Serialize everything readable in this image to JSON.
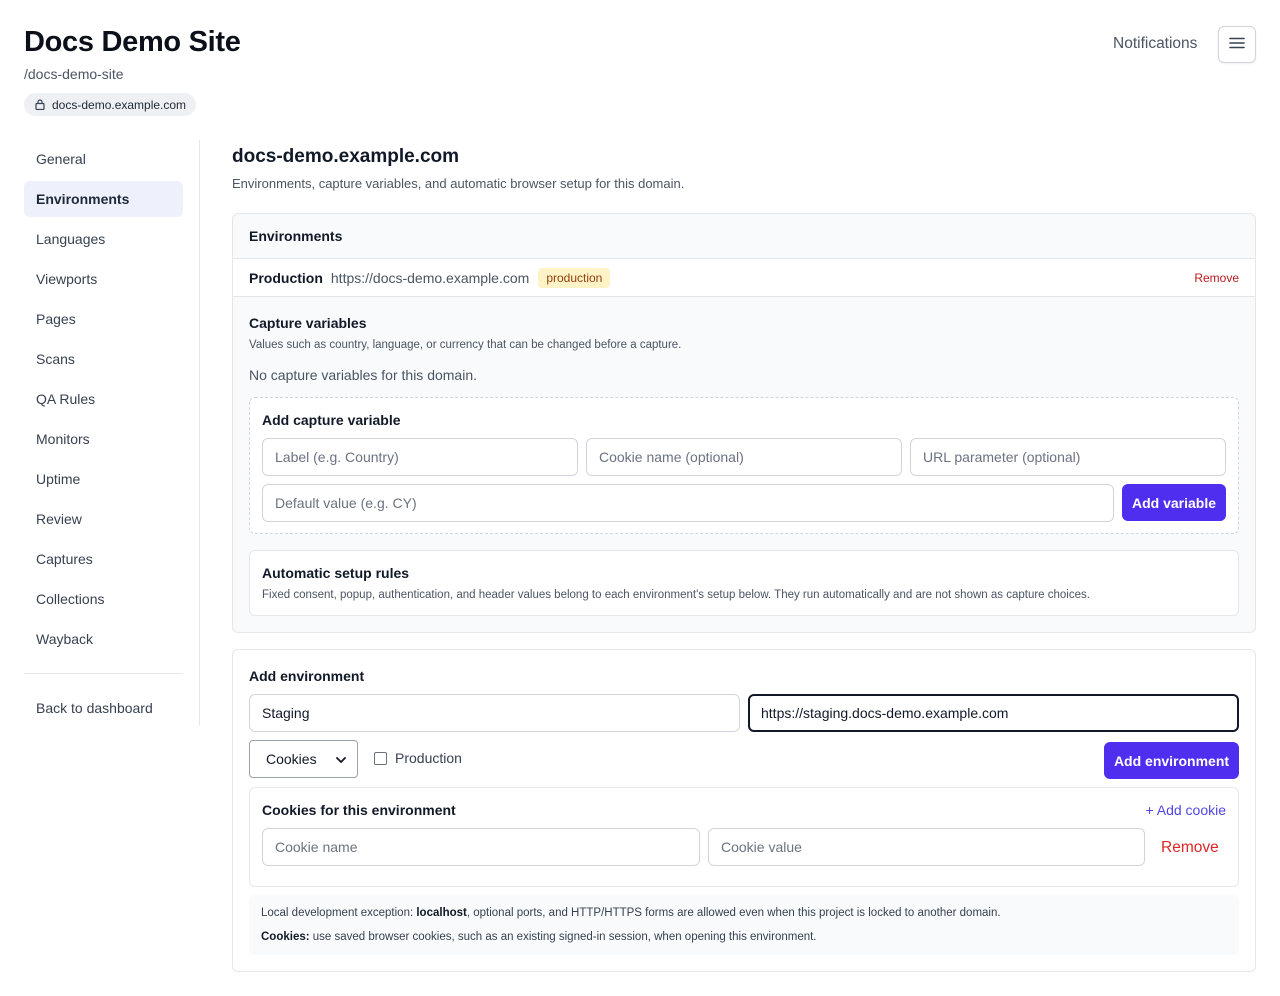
{
  "header": {
    "title": "Docs Demo Site",
    "slug": "/docs-demo-site",
    "domain": "docs-demo.example.com",
    "notifications_label": "Notifications",
    "menu_icon": "hamburger-menu-icon"
  },
  "sidebar": {
    "items": [
      {
        "label": "General",
        "active": false
      },
      {
        "label": "Environments",
        "active": true
      },
      {
        "label": "Languages",
        "active": false
      },
      {
        "label": "Viewports",
        "active": false
      },
      {
        "label": "Pages",
        "active": false
      },
      {
        "label": "Scans",
        "active": false
      },
      {
        "label": "QA Rules",
        "active": false
      },
      {
        "label": "Monitors",
        "active": false
      },
      {
        "label": "Uptime",
        "active": false
      },
      {
        "label": "Review",
        "active": false
      },
      {
        "label": "Captures",
        "active": false
      },
      {
        "label": "Collections",
        "active": false
      },
      {
        "label": "Wayback",
        "active": false
      }
    ],
    "back_label": "Back to dashboard"
  },
  "main": {
    "title": "docs-demo.example.com",
    "subtitle": "Environments, capture variables, and automatic browser setup for this domain.",
    "environments": {
      "heading": "Environments",
      "rows": [
        {
          "name": "Production",
          "url": "https://docs-demo.example.com",
          "badge": "production",
          "remove_label": "Remove"
        }
      ]
    },
    "capture_variables": {
      "title": "Capture variables",
      "help": "Values such as country, language, or currency that can be changed before a capture.",
      "empty": "No capture variables for this domain.",
      "add": {
        "title": "Add capture variable",
        "label_placeholder": "Label (e.g. Country)",
        "cookie_placeholder": "Cookie name (optional)",
        "param_placeholder": "URL parameter (optional)",
        "default_placeholder": "Default value (e.g. CY)",
        "button": "Add variable"
      }
    },
    "setup_rules": {
      "title": "Automatic setup rules",
      "help": "Fixed consent, popup, authentication, and header values belong to each environment's setup below. They run automatically and are not shown as capture choices."
    },
    "add_environment": {
      "title": "Add environment",
      "name_value": "Staging",
      "url_value": "https://staging.docs-demo.example.com",
      "setup_type": "Cookies",
      "production_label": "Production",
      "production_checked": false,
      "button": "Add environment",
      "cookies": {
        "title": "Cookies for this environment",
        "add_label": "+ Add cookie",
        "name_placeholder": "Cookie name",
        "value_placeholder": "Cookie value",
        "remove_label": "Remove"
      },
      "notes": {
        "line1_prefix": "Local development exception: ",
        "line1_bold": "localhost",
        "line1_suffix": ", optional ports, and HTTP/HTTPS forms are allowed even when this project is locked to another domain.",
        "line2_bold": "Cookies:",
        "line2_suffix": " use saved browser cookies, such as an existing signed-in session, when opening this environment."
      }
    }
  },
  "colors": {
    "accent": "#4f2ef0",
    "danger": "#b91c1c",
    "badge_bg": "#fef3c7",
    "active_nav_bg": "#eef0fb"
  }
}
